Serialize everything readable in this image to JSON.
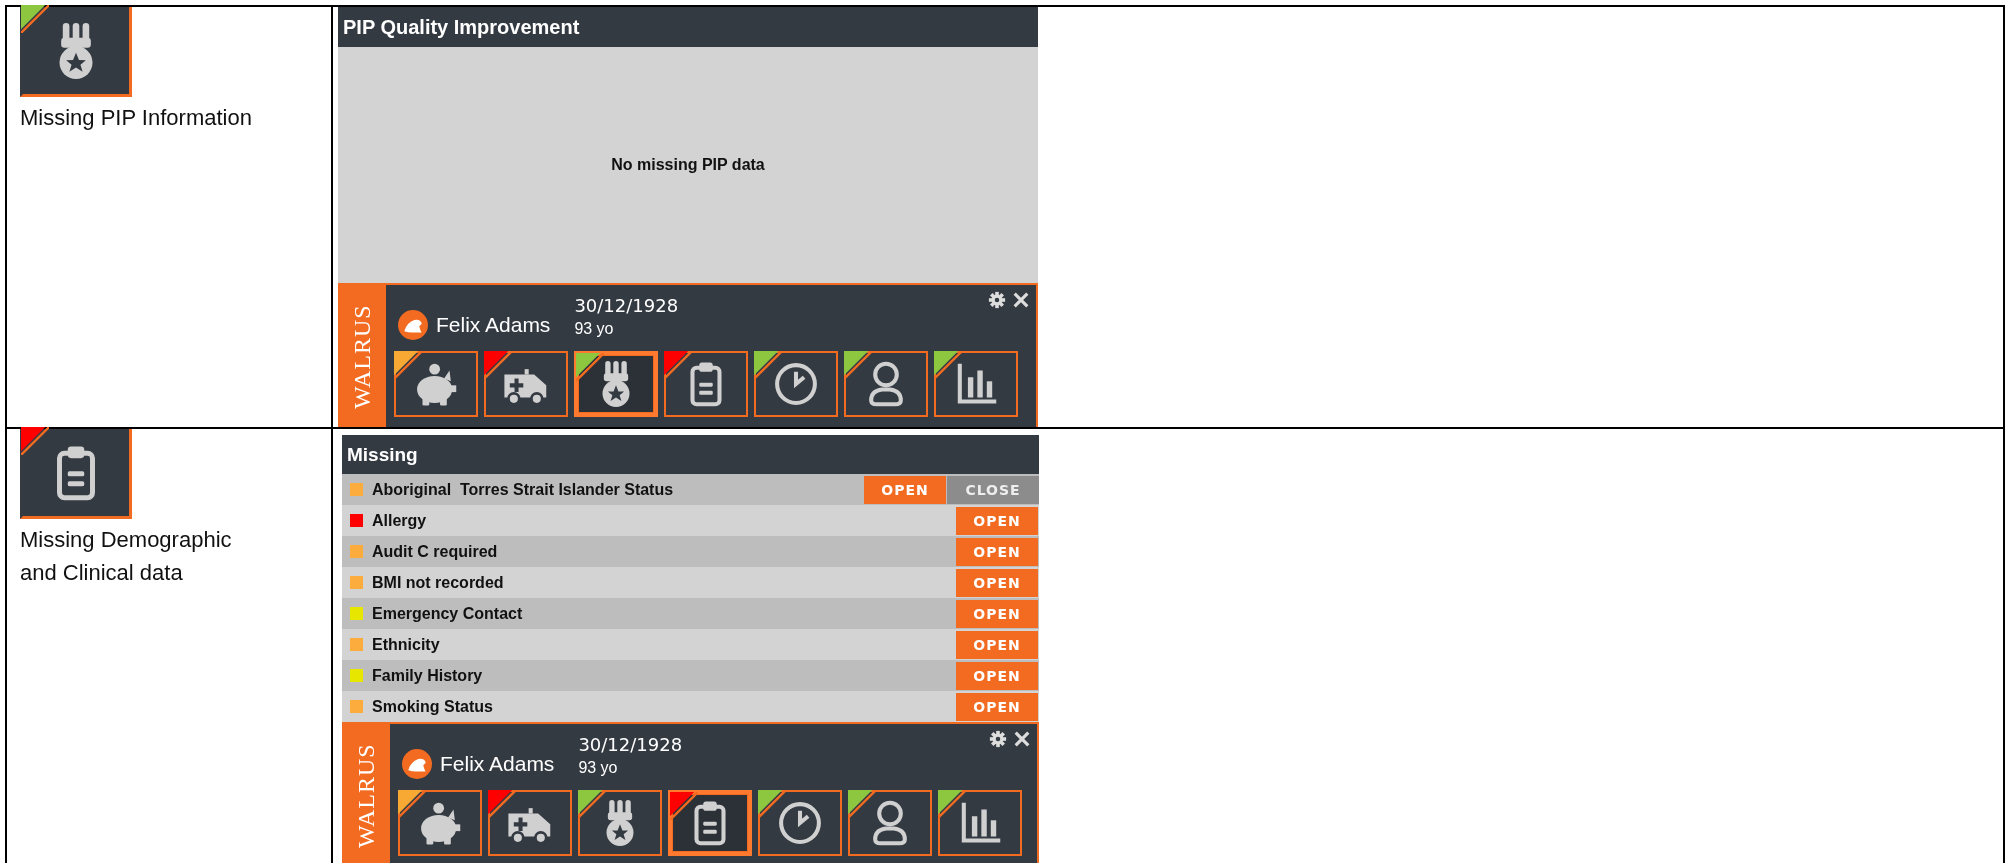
{
  "sections": [
    {
      "caption": "Missing PIP Information",
      "tile": {
        "kind": "medal",
        "color": "#8dc63f"
      },
      "panel": {
        "kind": "message",
        "title": "PIP Quality Improvement",
        "message": "No missing PIP data"
      },
      "patient_bar": {
        "brand": "WALRUS",
        "name": "Felix Adams",
        "dob": "30/12/1928",
        "age": "93 yo",
        "tiles": [
          {
            "kind": "piggy",
            "color": "#f7a934",
            "selected": false
          },
          {
            "kind": "ambulance",
            "color": "#ff0000",
            "selected": false
          },
          {
            "kind": "medal",
            "color": "#8dc63f",
            "selected": true
          },
          {
            "kind": "clipboard",
            "color": "#ff0000",
            "selected": false
          },
          {
            "kind": "clock",
            "color": "#8dc63f",
            "selected": false
          },
          {
            "kind": "person",
            "color": "#8dc63f",
            "selected": false
          },
          {
            "kind": "chart",
            "color": "#8dc63f",
            "selected": false
          }
        ]
      }
    },
    {
      "caption": "Missing Demographic and Clinical data",
      "tile": {
        "kind": "clipboard",
        "color": "#ff0000"
      },
      "panel": {
        "kind": "list",
        "title": "Missing",
        "rows": [
          {
            "label": "Aboriginal  Torres Strait Islander Status",
            "color": "#fbac3d",
            "buttons": [
              {
                "kind": "open",
                "label": "OPEN"
              },
              {
                "kind": "close",
                "label": "CLOSE"
              }
            ]
          },
          {
            "label": "Allergy",
            "color": "#ff0000",
            "buttons": [
              {
                "kind": "open",
                "label": "OPEN"
              }
            ]
          },
          {
            "label": "Audit C required",
            "color": "#fbac3d",
            "buttons": [
              {
                "kind": "open",
                "label": "OPEN"
              }
            ]
          },
          {
            "label": "BMI not recorded",
            "color": "#fbac3d",
            "buttons": [
              {
                "kind": "open",
                "label": "OPEN"
              }
            ]
          },
          {
            "label": "Emergency Contact",
            "color": "#e6e600",
            "buttons": [
              {
                "kind": "open",
                "label": "OPEN"
              }
            ]
          },
          {
            "label": "Ethnicity",
            "color": "#fbac3d",
            "buttons": [
              {
                "kind": "open",
                "label": "OPEN"
              }
            ]
          },
          {
            "label": "Family History",
            "color": "#e6e600",
            "buttons": [
              {
                "kind": "open",
                "label": "OPEN"
              }
            ]
          },
          {
            "label": "Smoking Status",
            "color": "#fbac3d",
            "buttons": [
              {
                "kind": "open",
                "label": "OPEN"
              }
            ]
          }
        ]
      },
      "patient_bar": {
        "brand": "WALRUS",
        "name": "Felix Adams",
        "dob": "30/12/1928",
        "age": "93 yo",
        "tiles": [
          {
            "kind": "piggy",
            "color": "#f7a934",
            "selected": false
          },
          {
            "kind": "ambulance",
            "color": "#ff0000",
            "selected": false
          },
          {
            "kind": "medal",
            "color": "#8dc63f",
            "selected": false
          },
          {
            "kind": "clipboard",
            "color": "#ff0000",
            "selected": true
          },
          {
            "kind": "clock",
            "color": "#8dc63f",
            "selected": false
          },
          {
            "kind": "person",
            "color": "#8dc63f",
            "selected": false
          },
          {
            "kind": "chart",
            "color": "#8dc63f",
            "selected": false
          }
        ]
      }
    }
  ]
}
